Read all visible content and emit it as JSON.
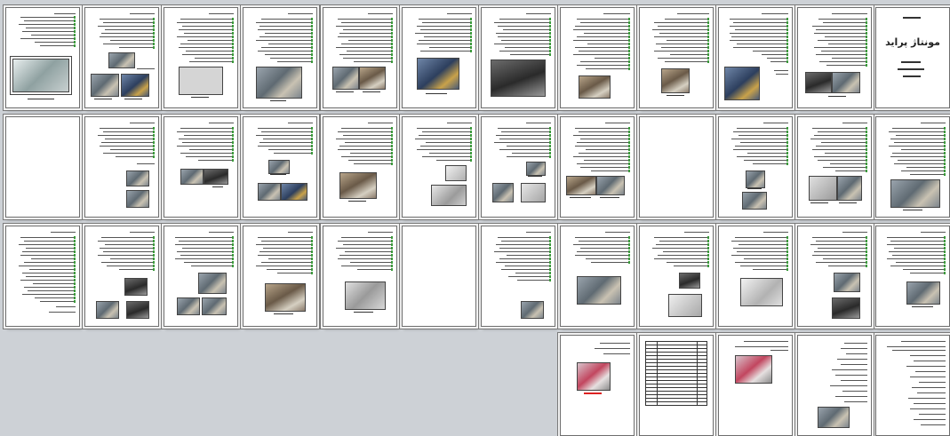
{
  "viewer": {
    "cover_title": "مونتاژ پراید"
  }
}
